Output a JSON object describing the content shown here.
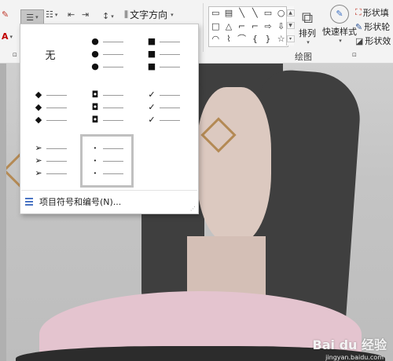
{
  "ribbon": {
    "text_direction_label": "文字方向",
    "arrange_label": "排列",
    "quick_styles_label": "快速样式",
    "drawing_group_label": "绘图",
    "shape_fill_label": "形状填",
    "shape_outline_label": "形状轮",
    "shape_effects_label": "形状效",
    "shape_gallery_icons": [
      "▭",
      "▤",
      "╲",
      "╲",
      "▭",
      "○",
      "□",
      "△",
      "⌐",
      "⌐",
      "⇨",
      "⇩",
      "◠",
      "⌇",
      "⌒",
      "{",
      "}",
      "☆"
    ]
  },
  "bullet_menu": {
    "none_label": "无",
    "options": [
      {
        "name": "none"
      },
      {
        "name": "filled-round",
        "symbol": "●"
      },
      {
        "name": "filled-square",
        "symbol": "■"
      },
      {
        "name": "diamond",
        "symbol": "◆"
      },
      {
        "name": "hollow-square",
        "symbol": "◘"
      },
      {
        "name": "checkmark",
        "symbol": "✓"
      },
      {
        "name": "arrowhead",
        "symbol": "➢"
      },
      {
        "name": "small-dot",
        "symbol": "•",
        "selected": true
      }
    ],
    "footer_label": "项目符号和编号(N)..."
  },
  "watermark": {
    "brand": "Bai du 经验",
    "url": "jingyan.baidu.com"
  },
  "colors": {
    "accent": "#4a74c4",
    "selection_border": "#c0c0c0",
    "ribbon_bg": "#f3f3f3"
  }
}
